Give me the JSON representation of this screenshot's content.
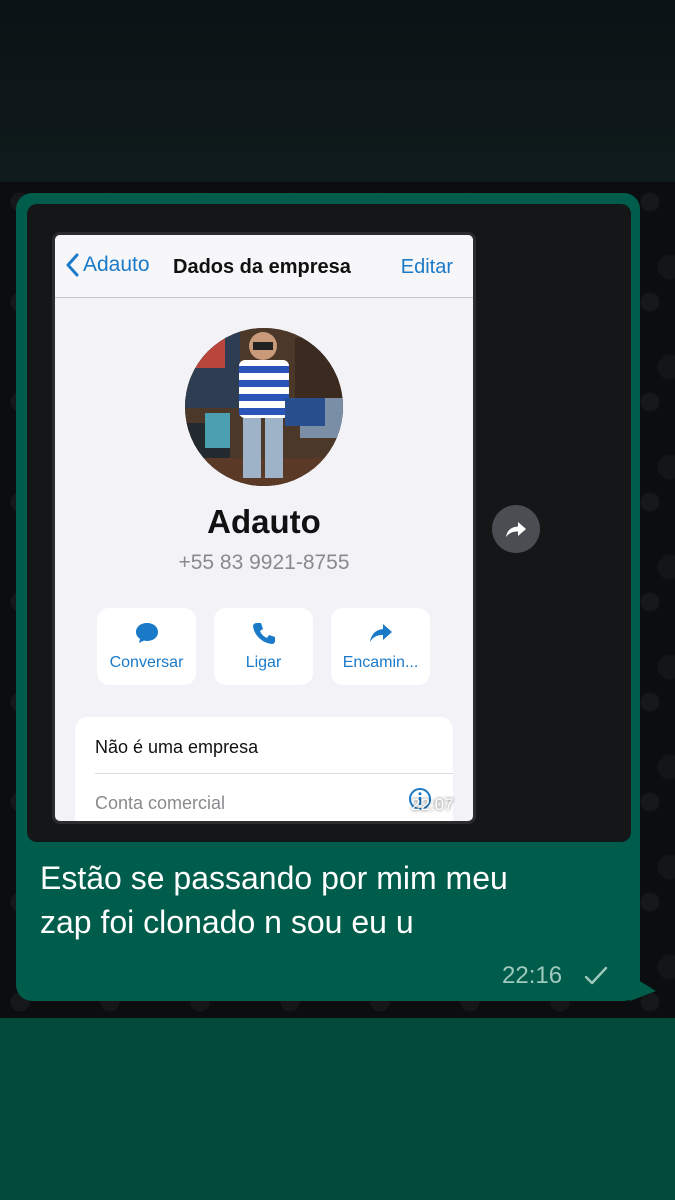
{
  "contact_screen": {
    "back_label": "Adauto",
    "title": "Dados da empresa",
    "edit_label": "Editar",
    "name": "Adauto",
    "phone": "+55 83 9921-8755",
    "actions": [
      {
        "label": "Conversar",
        "icon": "chat-bubble-icon"
      },
      {
        "label": "Ligar",
        "icon": "phone-icon"
      },
      {
        "label": "Encamin...",
        "icon": "forward-arrow-icon"
      }
    ],
    "info": {
      "line1": "Não é uma empresa",
      "line2": "Conta comercial"
    }
  },
  "media": {
    "timestamp": "22:07"
  },
  "message": {
    "text_line1": "Estão se passando por mim meu",
    "text_line2": "zap foi clonado n sou eu u",
    "time": "22:16",
    "status": "sent-single-check"
  },
  "colors": {
    "bubble": "#005c4b",
    "ios_blue": "#1a7ac8",
    "background": "#0b0d0e",
    "bottom_band": "#034a3a"
  }
}
